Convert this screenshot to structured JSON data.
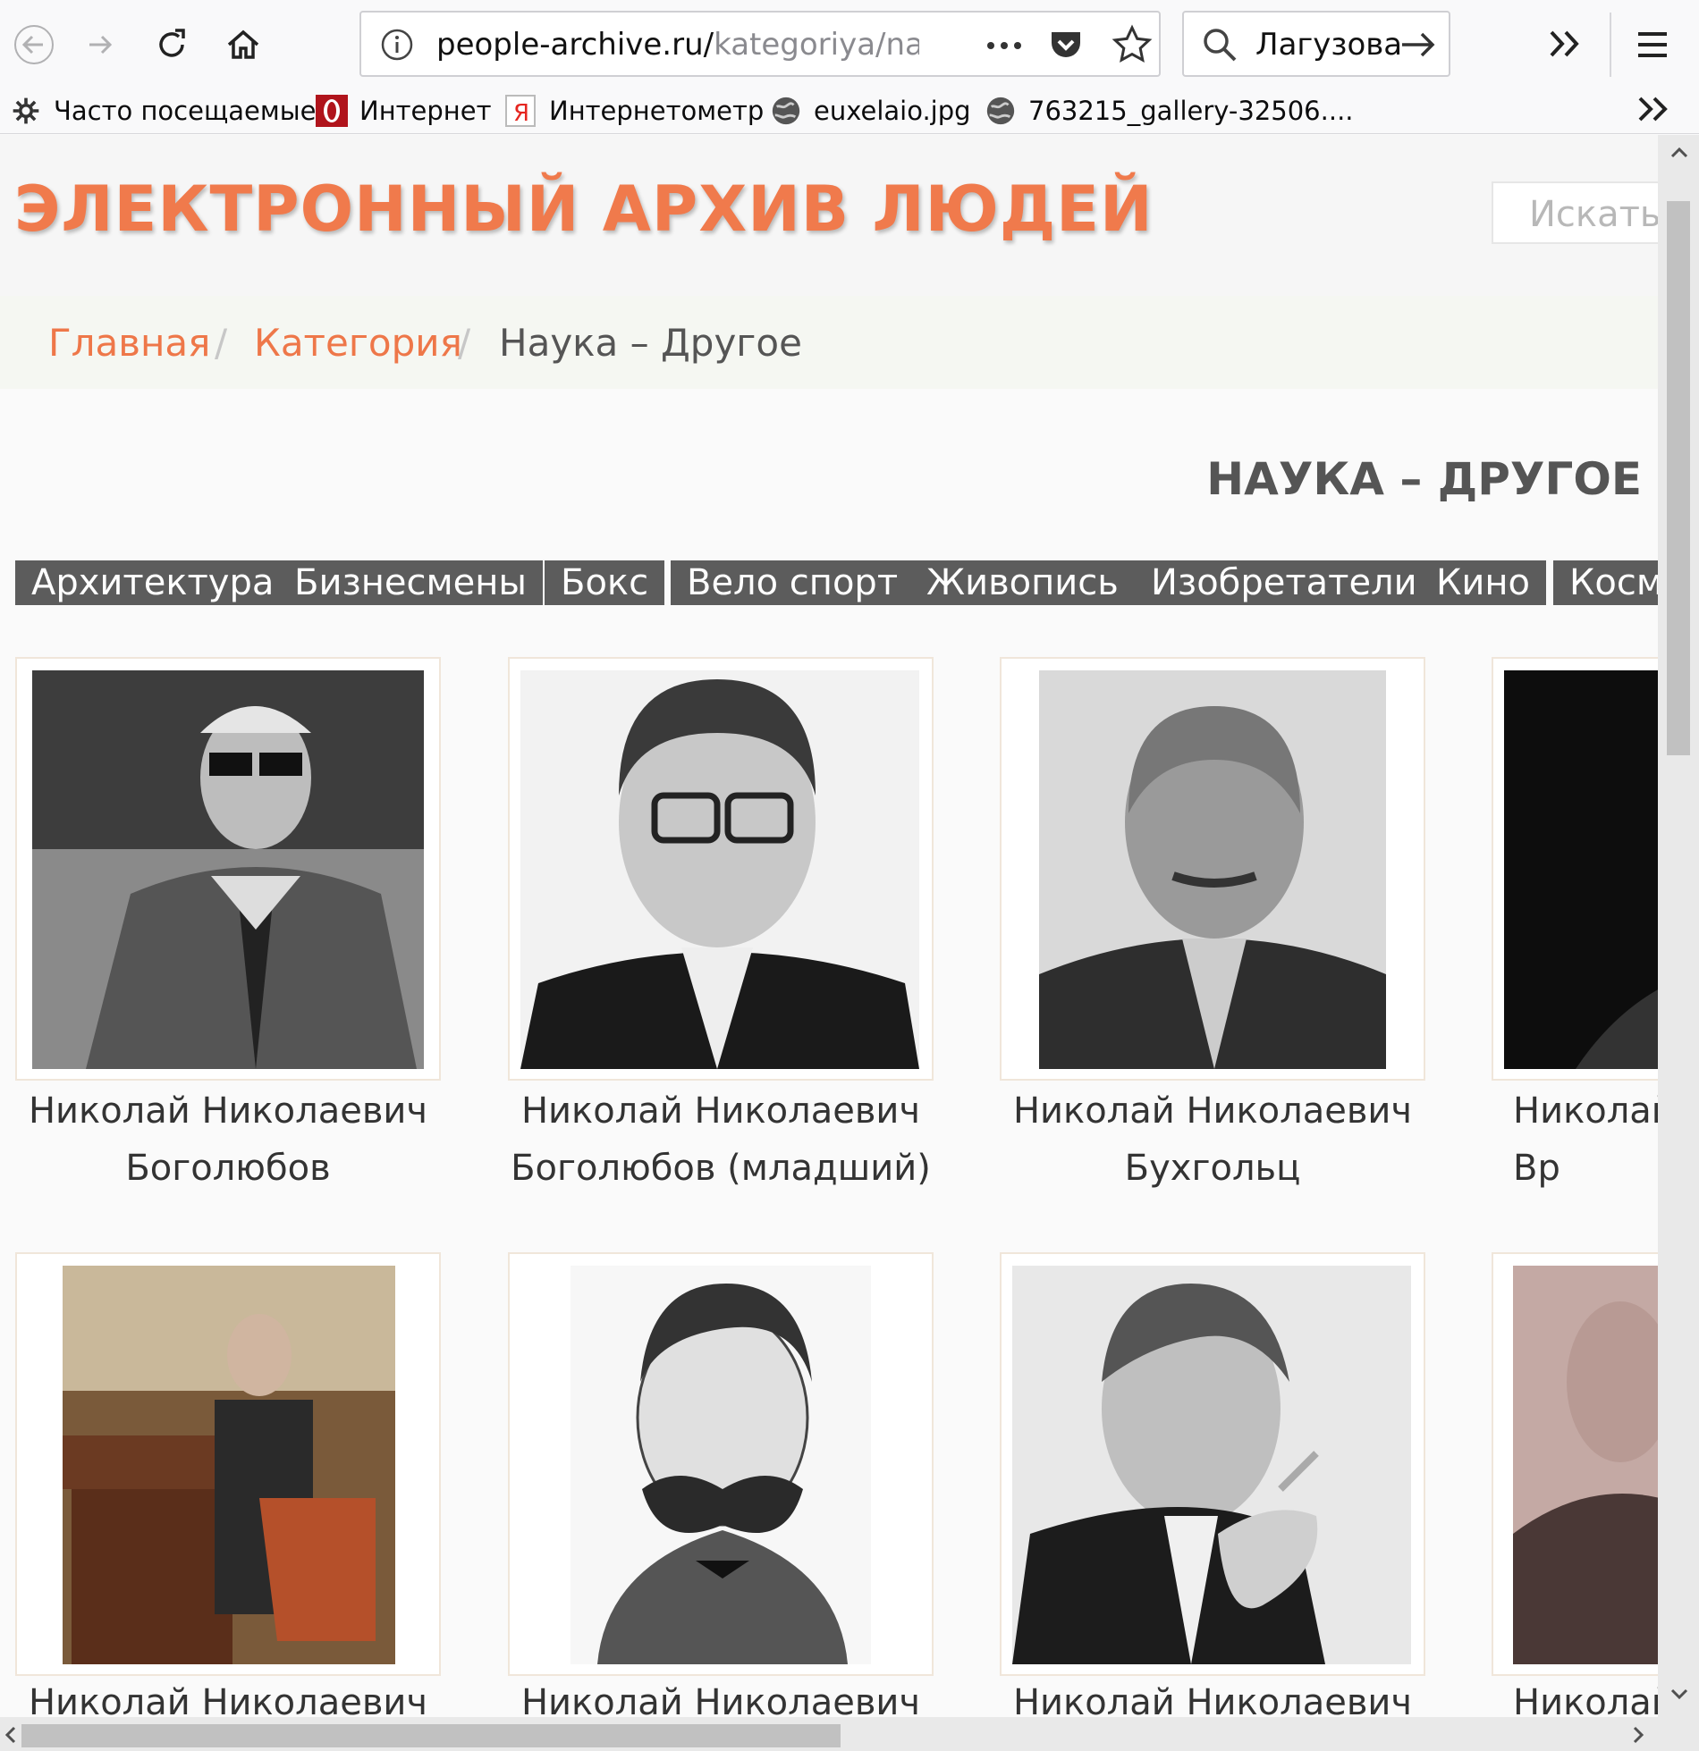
{
  "browser": {
    "url_main": "people-archive.ru/",
    "url_rest": "kategoriya/nauk",
    "search_value": "Лагузова"
  },
  "bookmarks": [
    {
      "label": "Часто посещаемые",
      "icon": "gear-icon"
    },
    {
      "label": "Интернет",
      "icon": "opera-icon"
    },
    {
      "label": "Интернетометр",
      "icon": "yandex-icon"
    },
    {
      "label": "euxelaio.jpg",
      "icon": "globe-icon"
    },
    {
      "label": "763215_gallery-32506....",
      "icon": "globe-icon"
    }
  ],
  "site": {
    "title": "ЭЛЕКТРОННЫЙ АРХИВ ЛЮДЕЙ",
    "search_placeholder": "Искать",
    "accent_color": "#f07a4c"
  },
  "breadcrumb": {
    "home": "Главная",
    "category": "Категория",
    "current": "Наука – Другое",
    "separator": "/"
  },
  "page_heading": "НАУКА – ДРУГОЕ",
  "tags": [
    "Архитектура",
    "Бизнесмены",
    "Бокс",
    "Вело спорт",
    "Живопись",
    "Изобретатели",
    "Кино",
    "Косм"
  ],
  "people": [
    {
      "name": "Николай Николаевич\nБоголюбов"
    },
    {
      "name": "Николай Николаевич\nБоголюбов (младший)"
    },
    {
      "name": "Николай Николаевич\nБухгольц"
    },
    {
      "name": "Николай\nВр"
    },
    {
      "name": "Николай Николаевич"
    },
    {
      "name": "Николай Николаевич"
    },
    {
      "name": "Николай Николаевич"
    },
    {
      "name": "Николай"
    }
  ]
}
